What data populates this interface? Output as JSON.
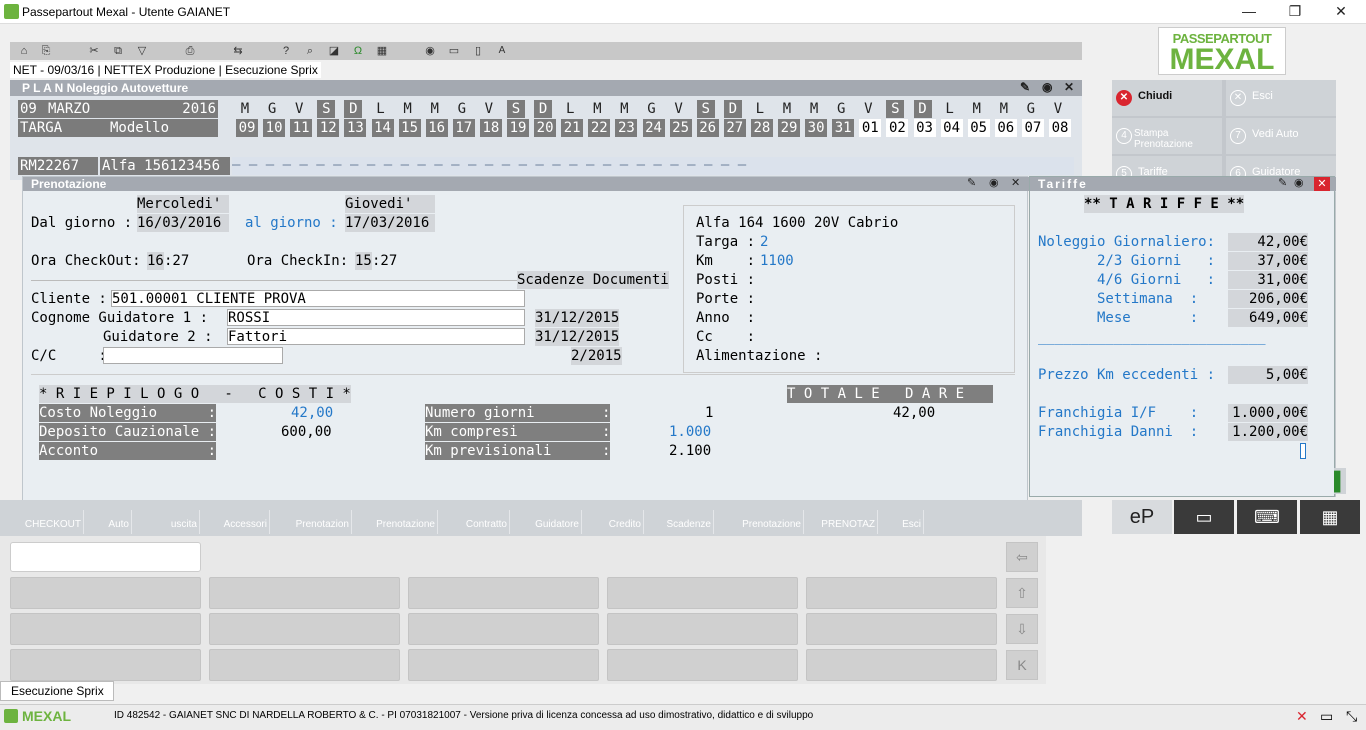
{
  "window": {
    "title": "Passepartout Mexal - Utente GAIANET",
    "min": "—",
    "max": "❐",
    "close": "✕"
  },
  "logo": {
    "line1": "PASSEPARTOUT",
    "line2": "MEXAL"
  },
  "status": {
    "line": "NET - 09/03/16 | NETTEX Produzione | Esecuzione Sprix"
  },
  "plan": {
    "title": "P L A N   Noleggio Autovetture",
    "day": "09",
    "month": "MARZO",
    "year": "2016",
    "targa": "TARGA",
    "modello": "Modello",
    "weekdays": [
      "M",
      "G",
      "V",
      "S",
      "D",
      "L",
      "M",
      "M",
      "G",
      "V",
      "S",
      "D",
      "L",
      "M",
      "M",
      "G",
      "V",
      "S",
      "D",
      "L",
      "M",
      "M",
      "G",
      "V",
      "S",
      "D",
      "L",
      "M",
      "M",
      "G",
      "V"
    ],
    "dates": [
      "09",
      "10",
      "11",
      "12",
      "13",
      "14",
      "15",
      "16",
      "17",
      "18",
      "19",
      "20",
      "21",
      "22",
      "23",
      "24",
      "25",
      "26",
      "27",
      "28",
      "29",
      "30",
      "31",
      "01",
      "02",
      "03",
      "04",
      "05",
      "06",
      "07",
      "08"
    ],
    "weekend_idx": [
      3,
      4,
      10,
      11,
      17,
      18,
      24,
      25
    ],
    "next_month_from": 23,
    "row_plate": "RM22267",
    "row_model": "Alfa 156123456"
  },
  "pren": {
    "title": "Prenotazione",
    "day_from_name": "Mercoledi'",
    "day_to_name": "Giovedi'",
    "dal_label": "Dal giorno :",
    "dal_value": "16/03/2016",
    "al_label": "al giorno :",
    "al_value": "17/03/2016",
    "checkout_label": "Ora CheckOut:",
    "checkout_h": "16",
    "checkout_m": ":27",
    "checkin_label": "Ora CheckIn:",
    "checkin_h": "15",
    "checkin_m": ":27",
    "scadenze": "Scadenze Documenti",
    "cliente_label": "Cliente :",
    "cliente_value": "501.00001 CLIENTE PROVA",
    "g1_label": "Cognome Guidatore 1 :",
    "g1_value": "ROSSI",
    "g1_date": "31/12/2015",
    "g2_label": "Guidatore 2 :",
    "g2_value": "Fattori",
    "g2_date": "31/12/2015",
    "cc_label": "C/C     :",
    "cc_date": "2/2015",
    "car_model": "Alfa 164 1600 20V Cabrio",
    "car_fields": [
      {
        "label": "Targa :",
        "value": "2"
      },
      {
        "label": "Km    :",
        "value": "1100"
      },
      {
        "label": "Posti :",
        "value": ""
      },
      {
        "label": "Porte :",
        "value": ""
      },
      {
        "label": "Anno  :",
        "value": ""
      },
      {
        "label": "Cc    :",
        "value": ""
      },
      {
        "label": "Alimentazione :",
        "value": ""
      }
    ],
    "riepilogo": "* R I E P I L O G O   -   C O S T I *",
    "totale": "T O T A L E   D A R E",
    "costo_label": "Costo Noleggio      :",
    "costo_value": "42,00",
    "deposito_label": "Deposito Cauzionale :",
    "deposito_value": "600,00",
    "acconto_label": "Acconto             :",
    "ngiorni_label": "Numero giorni        :",
    "ngiorni_value": "1",
    "ngiorni_total": "42,00",
    "kmcompresi_label": "Km compresi          :",
    "kmcompresi_value": "1.000",
    "kmprev_label": "Km previsionali      :",
    "kmprev_value": "2.100"
  },
  "tariffe": {
    "title": "Tariffe",
    "heading": "** T A R I F F E **",
    "rows": [
      {
        "label": "Noleggio Giornaliero:",
        "value": " 42,00€"
      },
      {
        "label": "       2/3 Giorni   :",
        "value": " 37,00€"
      },
      {
        "label": "       4/6 Giorni   :",
        "value": " 31,00€"
      },
      {
        "label": "       Settimana  :",
        "value": " 206,00€"
      },
      {
        "label": "       Mese       :",
        "value": " 649,00€"
      }
    ],
    "line": "___________________________",
    "prezzo_label": "Prezzo Km eccedenti :",
    "prezzo_value": "  5,00€",
    "franchigia_if_label": "Franchigia I/F    :",
    "franchigia_if_value": "1.000,00€",
    "franchigia_danni_label": "Franchigia Danni  :",
    "franchigia_danni_value": "1.200,00€"
  },
  "rightpanel": {
    "chiudi": "Chiudi",
    "esci": "Esci",
    "stampa": "Stampa Prenotazione",
    "vedi": "Vedi Auto",
    "tariffe": "Tariffe",
    "guidatore": "Guidatore"
  },
  "fkeys": [
    "CHECKOUT",
    "Auto",
    "uscita",
    "Accessori",
    "Prenotazion",
    "Prenotazione",
    "Contratto",
    "Guidatore",
    "Credito",
    "Scadenze",
    "Prenotazione",
    "PRENOTAZ",
    "Esci"
  ],
  "tab": {
    "label": "Esecuzione Sprix"
  },
  "statusbar": {
    "brand": "MEXAL",
    "text": "ID 482542 - GAIANET SNC DI NARDELLA ROBERTO & C. - PI 07031821007 - Versione priva di licenza concessa ad uso dimostrativo, didattico e di sviluppo"
  },
  "colors": {
    "accent": "#2478c8",
    "header": "#a4a9b1",
    "mexal_green": "#6db33f",
    "close_red": "#d9252f"
  }
}
